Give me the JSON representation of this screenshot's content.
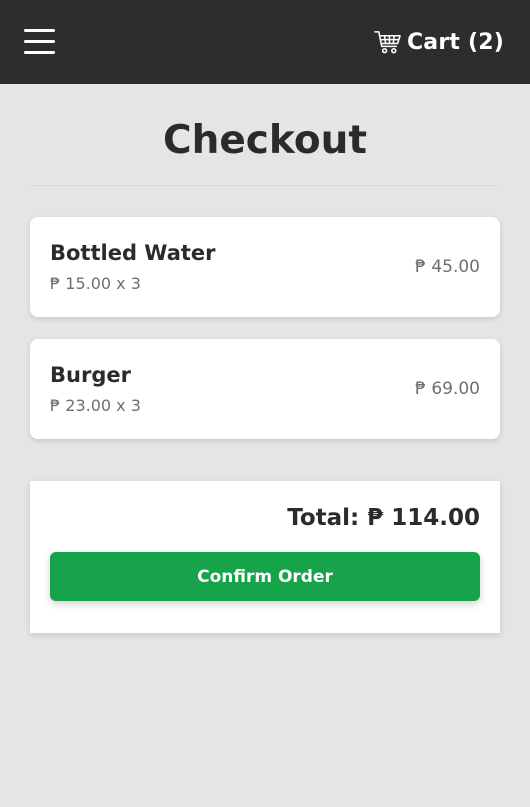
{
  "header": {
    "menu_icon": "hamburger-menu-icon",
    "cart_icon": "shopping-cart-icon",
    "cart_label": "Cart (2)"
  },
  "page": {
    "title": "Checkout"
  },
  "items": [
    {
      "name": "Bottled Water",
      "price_qty": "₱ 15.00 x 3",
      "line_total": "₱ 45.00"
    },
    {
      "name": "Burger",
      "price_qty": "₱ 23.00 x 3",
      "line_total": "₱ 69.00"
    }
  ],
  "summary": {
    "total_label": "Total: ₱ 114.00",
    "confirm_label": "Confirm Order"
  },
  "colors": {
    "header_bg": "#2d2d2d",
    "page_bg": "#e5e5e5",
    "confirm_button": "#16a34a"
  }
}
